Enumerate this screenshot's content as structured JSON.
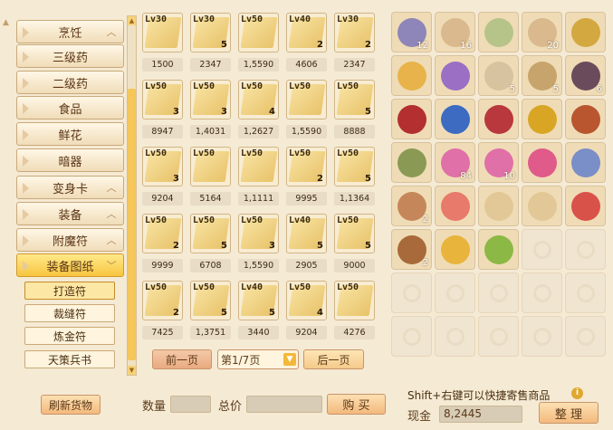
{
  "categories": [
    {
      "label": "烹饪",
      "chevron": "up"
    },
    {
      "label": "三级药",
      "chevron": ""
    },
    {
      "label": "二级药",
      "chevron": ""
    },
    {
      "label": "食品",
      "chevron": ""
    },
    {
      "label": "鲜花",
      "chevron": ""
    },
    {
      "label": "暗器",
      "chevron": ""
    },
    {
      "label": "变身卡",
      "chevron": "up"
    },
    {
      "label": "装备",
      "chevron": "up"
    },
    {
      "label": "附魔符",
      "chevron": "up"
    },
    {
      "label": "装备图纸",
      "chevron": "down"
    }
  ],
  "subcategories": [
    "打造符",
    "裁缝符",
    "炼金符",
    "天策兵书"
  ],
  "goods": [
    {
      "lv": "Lv30",
      "qty": "",
      "price": "1500"
    },
    {
      "lv": "Lv30",
      "qty": "5",
      "price": "2347"
    },
    {
      "lv": "Lv50",
      "qty": "",
      "price": "1,5590"
    },
    {
      "lv": "Lv40",
      "qty": "2",
      "price": "4606"
    },
    {
      "lv": "Lv30",
      "qty": "2",
      "price": "2347"
    },
    {
      "lv": "Lv50",
      "qty": "3",
      "price": "8947"
    },
    {
      "lv": "Lv50",
      "qty": "3",
      "price": "1,4031"
    },
    {
      "lv": "Lv50",
      "qty": "4",
      "price": "1,2627"
    },
    {
      "lv": "Lv50",
      "qty": "",
      "price": "1,5590"
    },
    {
      "lv": "Lv50",
      "qty": "5",
      "price": "8888"
    },
    {
      "lv": "Lv50",
      "qty": "3",
      "price": "9204"
    },
    {
      "lv": "Lv50",
      "qty": "",
      "price": "5164"
    },
    {
      "lv": "Lv50",
      "qty": "",
      "price": "1,1111"
    },
    {
      "lv": "Lv50",
      "qty": "2",
      "price": "9995"
    },
    {
      "lv": "Lv50",
      "qty": "5",
      "price": "1,1364"
    },
    {
      "lv": "Lv50",
      "qty": "2",
      "price": "9999"
    },
    {
      "lv": "Lv50",
      "qty": "5",
      "price": "6708"
    },
    {
      "lv": "Lv50",
      "qty": "3",
      "price": "1,5590"
    },
    {
      "lv": "Lv40",
      "qty": "5",
      "price": "2905"
    },
    {
      "lv": "Lv50",
      "qty": "5",
      "price": "9000"
    },
    {
      "lv": "Lv50",
      "qty": "2",
      "price": "7425"
    },
    {
      "lv": "Lv50",
      "qty": "5",
      "price": "1,3751"
    },
    {
      "lv": "Lv40",
      "qty": "5",
      "price": "3440"
    },
    {
      "lv": "Lv50",
      "qty": "4",
      "price": "9204"
    },
    {
      "lv": "Lv50",
      "qty": "",
      "price": "4276"
    }
  ],
  "pager": {
    "prev": "前一页",
    "page": "第1/7页",
    "next": "后一页"
  },
  "bottom": {
    "refresh": "刷新货物",
    "qty_label": "数量",
    "total_label": "总价",
    "buy": "购 买",
    "hint": "Shift+右键可以快捷寄售商品",
    "cash_label": "现金",
    "cash": "8,2445",
    "organize": "整 理"
  },
  "inventory": [
    {
      "name": "map-icon",
      "color": "#8e86b8",
      "cnt": "12"
    },
    {
      "name": "sand-icon",
      "color": "#d9b98d",
      "cnt": "16"
    },
    {
      "name": "flag-icon",
      "color": "#b6c48a",
      "cnt": ""
    },
    {
      "name": "sand-icon",
      "color": "#d9b98d",
      "cnt": "20"
    },
    {
      "name": "scroll-icon",
      "color": "#d4a840",
      "cnt": ""
    },
    {
      "name": "yellow-flower-icon",
      "color": "#e7b34a",
      "cnt": ""
    },
    {
      "name": "purple-flower-icon",
      "color": "#9a6fc4",
      "cnt": ""
    },
    {
      "name": "egg-icon",
      "color": "#d8c3a0",
      "cnt": "5"
    },
    {
      "name": "bowl-icon",
      "color": "#c7a46c",
      "cnt": "5"
    },
    {
      "name": "stone-icon",
      "color": "#6a4b5b",
      "cnt": "6"
    },
    {
      "name": "armor-icon",
      "color": "#b42f2f",
      "cnt": ""
    },
    {
      "name": "wings-icon",
      "color": "#3d6bc2",
      "cnt": ""
    },
    {
      "name": "necklace-icon",
      "color": "#b8383e",
      "cnt": ""
    },
    {
      "name": "amulet-icon",
      "color": "#d9a524",
      "cnt": ""
    },
    {
      "name": "ring-icon",
      "color": "#b9562f",
      "cnt": ""
    },
    {
      "name": "herb-icon",
      "color": "#8a9a54",
      "cnt": ""
    },
    {
      "name": "pink-orb-icon",
      "color": "#e070a8",
      "cnt": "84"
    },
    {
      "name": "pink-orb-icon",
      "color": "#e070a8",
      "cnt": "10"
    },
    {
      "name": "feather-icon",
      "color": "#e05a8a",
      "cnt": ""
    },
    {
      "name": "fan-icon",
      "color": "#7a8ec8",
      "cnt": ""
    },
    {
      "name": "book-icon",
      "color": "#c5875a",
      "cnt": "2"
    },
    {
      "name": "peach-icon",
      "color": "#e77a6a",
      "cnt": ""
    },
    {
      "name": "blueprint-icon",
      "color": "#e2c896",
      "cnt": ""
    },
    {
      "name": "blueprint-icon",
      "color": "#e2c896",
      "cnt": ""
    },
    {
      "name": "red-swirl-icon",
      "color": "#d9524a",
      "cnt": ""
    },
    {
      "name": "manual-icon",
      "color": "#a86a3a",
      "cnt": "2"
    },
    {
      "name": "gold-swirl-icon",
      "color": "#e8b43c",
      "cnt": ""
    },
    {
      "name": "green-swirl-icon",
      "color": "#8cb846",
      "cnt": ""
    },
    {
      "name": "",
      "color": "",
      "cnt": ""
    },
    {
      "name": "",
      "color": "",
      "cnt": ""
    },
    {
      "name": "",
      "color": "",
      "cnt": ""
    },
    {
      "name": "",
      "color": "",
      "cnt": ""
    },
    {
      "name": "",
      "color": "",
      "cnt": ""
    },
    {
      "name": "",
      "color": "",
      "cnt": ""
    },
    {
      "name": "",
      "color": "",
      "cnt": ""
    },
    {
      "name": "",
      "color": "",
      "cnt": ""
    },
    {
      "name": "",
      "color": "",
      "cnt": ""
    },
    {
      "name": "",
      "color": "",
      "cnt": ""
    },
    {
      "name": "",
      "color": "",
      "cnt": ""
    },
    {
      "name": "",
      "color": "",
      "cnt": ""
    }
  ]
}
